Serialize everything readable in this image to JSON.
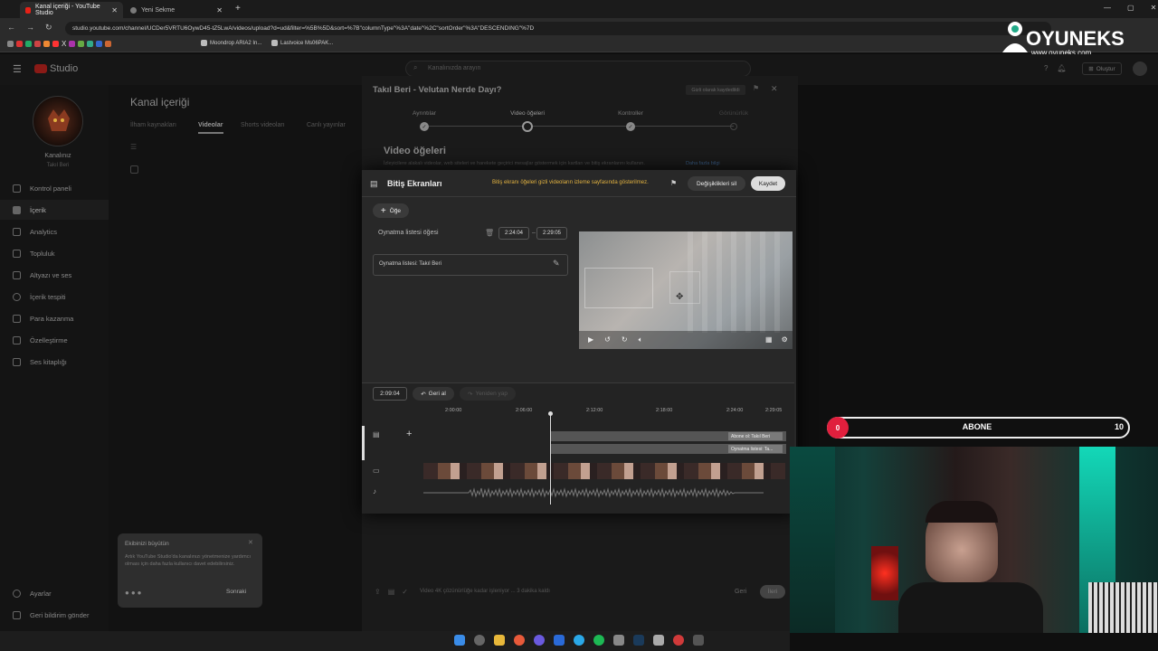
{
  "browser": {
    "tabs": [
      {
        "label": "Kanal içeriği - YouTube Studio"
      },
      {
        "label": "Yeni Sekme"
      }
    ],
    "url": "studio.youtube.com/channel/UCDer5VRTU6OywD45-tZ5LwA/videos/upload?d=ud&filter=%5B%5D&sort=%7B\"columnType\"%3A\"date\"%2C\"sortOrder\"%3A\"DESCENDING\"%7D",
    "bookmarks": [
      "Moondrop ARIA2 In...",
      "Lastvoice Ms06PAK..."
    ]
  },
  "watermark": {
    "brand": "OYUNEKS",
    "site": "www.oyuneks.com"
  },
  "studio": {
    "logo": "Studio",
    "search_placeholder": "Kanalınızda arayın",
    "create_label": "Oluştur",
    "channel_label": "Kanalınız",
    "channel_name": "Takıl Beri",
    "nav": [
      "Kontrol paneli",
      "İçerik",
      "Analytics",
      "Topluluk",
      "Altyazı ve ses",
      "İçerik tespiti",
      "Para kazanma",
      "Özelleştirme",
      "Ses kitaplığı"
    ],
    "settings": "Ayarlar",
    "feedback": "Geri bildirim gönder",
    "page_title": "Kanal içeriği",
    "content_tabs": [
      "İlham kaynakları",
      "Videolar",
      "Shorts videoları",
      "Canlı yayınlar"
    ]
  },
  "wizard": {
    "title": "Takıl Beri - Velutan Nerde Dayı?",
    "saved_badge": "Gizli olarak kaydedildi",
    "steps": [
      "Ayrıntılar",
      "Video öğeleri",
      "Kontroller",
      "Görünürlük"
    ],
    "section_title": "Video öğeleri",
    "section_desc": "İzleyicilere alakalı videolar, web siteleri ve harekete geçirici mesajlar göstermek için kartları ve bitiş ekranlarını kullanın.",
    "learn_more": "Daha fazla bilgi",
    "footer_text": "Video 4K çözünürlüğe kadar işleniyor ... 3 dakika kaldı",
    "back_label": "Geri",
    "next_label": "İleri"
  },
  "end_screen": {
    "title": "Bitiş Ekranları",
    "notice": "Bitiş ekranı öğeleri gizli videoların izleme sayfasında gösterilmez.",
    "discard_label": "Değişiklikleri sil",
    "save_label": "Kaydet",
    "add_element_label": "Öğe",
    "element_name": "Oynatma listesi öğesi",
    "start_time": "2:24:04",
    "end_time": "2:29:05",
    "playlist_field": "Oynatma listesi: Takıl Beri",
    "current_time": "2:09:04",
    "undo_label": "Geri al",
    "redo_label": "Yeniden yap",
    "ruler_ticks": [
      "2:00:00",
      "2:06:00",
      "2:12:00",
      "2:18:00",
      "2:24:00",
      "2:29:05"
    ],
    "track_labels": [
      "Abone ol: Takıl Beri",
      "Oynatma listesi: Ta..."
    ]
  },
  "toast": {
    "title": "Ekibinizi büyütün",
    "body": "Artık YouTube Studio'da kanalınızı yönetmenize yardımcı olması için daha fazla kullanıcı davet edebilirsiniz.",
    "next_label": "Sonraki"
  },
  "overlay": {
    "label": "ABONE",
    "count_left": "0",
    "count_right": "10"
  }
}
